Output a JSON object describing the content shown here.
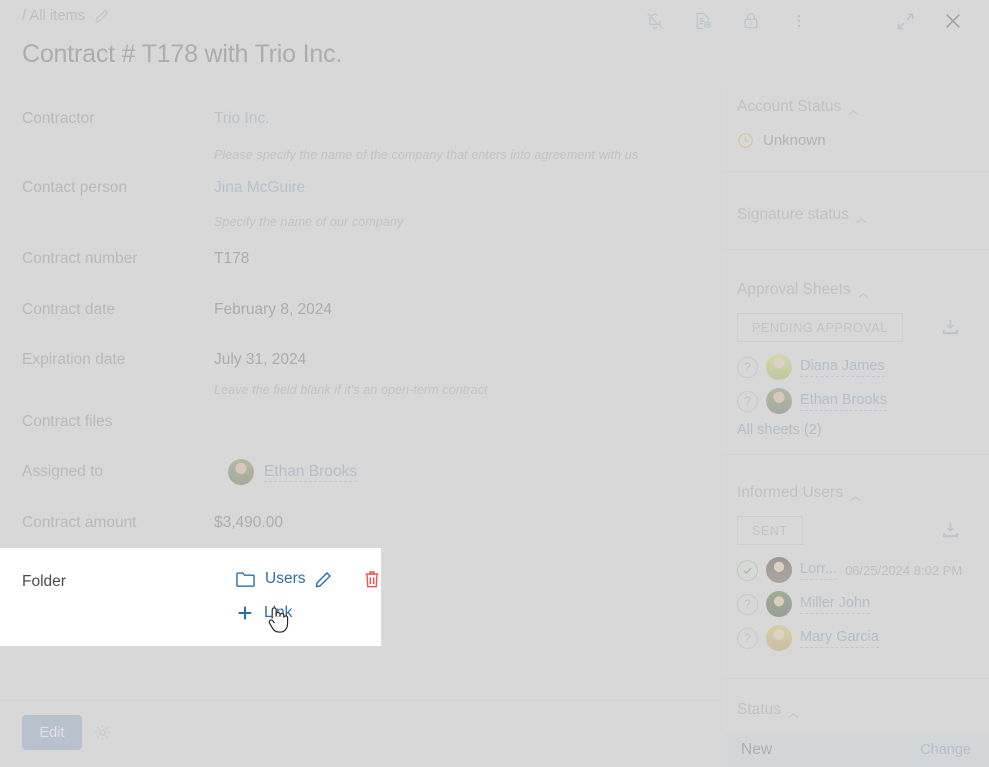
{
  "header": {
    "breadcrumb": "/ All items",
    "breadcrumb_edit_icon": "pencil-icon",
    "title": "Contract # T178 with Trio Inc.",
    "tools": [
      {
        "name": "bell-off-icon",
        "label": "Mute notifications"
      },
      {
        "name": "document-add-icon",
        "label": "Create document"
      },
      {
        "name": "lock-icon",
        "label": "Access permissions"
      },
      {
        "name": "more-vertical-icon",
        "label": "More actions"
      },
      {
        "name": "expand-icon",
        "label": "Expand"
      },
      {
        "name": "close-icon",
        "label": "Close"
      }
    ]
  },
  "fields": {
    "contractor": {
      "label": "Contractor",
      "value": "Trio Inc.",
      "hint": "Please specify the name of the company that enters into agreement with us"
    },
    "contact_person": {
      "label": "Contact person",
      "value": "Jina McGuire",
      "hint": "Specify the name of our company"
    },
    "contract_number": {
      "label": "Contract number",
      "value": "T178"
    },
    "contract_date": {
      "label": "Contract date",
      "value": "February 8, 2024"
    },
    "expiration_date": {
      "label": "Expiration date",
      "value": "July 31, 2024",
      "hint": "Leave the field blank if it's an open-term contract"
    },
    "contract_files": {
      "label": "Contract files",
      "value": ""
    },
    "assigned_to": {
      "label": "Assigned to",
      "value": "Ethan Brooks"
    },
    "contract_amount": {
      "label": "Contract amount",
      "value": "$3,490.00"
    }
  },
  "folder_popup": {
    "label": "Folder",
    "folder_icon": "folder-icon",
    "folder_name": "Users",
    "edit_icon": "pencil-icon",
    "delete_icon": "trash-icon",
    "add_icon": "plus-icon",
    "add_label": "Link",
    "cursor": "pointer-hand-cursor"
  },
  "footer": {
    "edit_label": "Edit",
    "settings_icon": "gear-icon"
  },
  "sidebar": {
    "account_status": {
      "title": "Account Status",
      "status_icon": "clock-icon",
      "status": "Unknown"
    },
    "signature_status": {
      "title": "Signature status"
    },
    "approval_sheets": {
      "title": "Approval Sheets",
      "badge": "PENDING APPROVAL",
      "download_icon": "download-icon",
      "users": [
        {
          "state_icon": "question-icon",
          "name": "Diana James"
        },
        {
          "state_icon": "question-icon",
          "name": "Ethan Brooks"
        }
      ],
      "all_link": "All sheets (2)"
    },
    "informed_users": {
      "title": "Informed Users",
      "badge": "SENT",
      "download_icon": "download-icon",
      "users": [
        {
          "state_icon": "check-icon",
          "name": "Lorr...",
          "time": "06/25/2024 8:02 PM"
        },
        {
          "state_icon": "question-icon",
          "name": "Miller John",
          "time": ""
        },
        {
          "state_icon": "question-icon",
          "name": "Mary Garcia",
          "time": ""
        }
      ]
    },
    "status": {
      "title": "Status",
      "value": "New",
      "change_label": "Change"
    }
  },
  "colors": {
    "page_bg": "#d8d8d8",
    "link": "#2e6da4",
    "muted_link": "#7d99b4",
    "danger": "#ef5350",
    "accent_button": "#8ba4bd",
    "status_bar": "#ccd6dd",
    "warning": "#d9b13c",
    "success": "#5da35d"
  }
}
